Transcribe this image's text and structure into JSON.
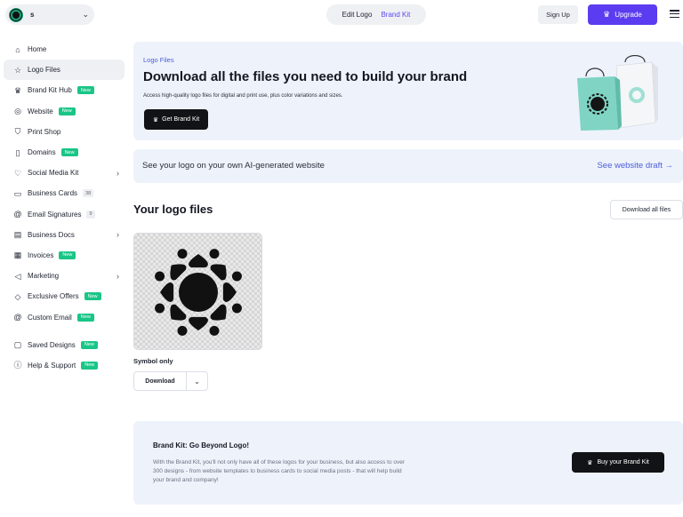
{
  "topbar": {
    "project_name": "s",
    "tabs": {
      "edit_logo": "Edit Logo",
      "brand_kit": "Brand Kit"
    },
    "sign_up": "Sign Up",
    "upgrade": "Upgrade"
  },
  "sidebar": {
    "items": [
      {
        "label": "Home",
        "icon": "home-icon"
      },
      {
        "label": "Logo Files",
        "icon": "star-icon",
        "active": true
      },
      {
        "label": "Brand Kit Hub",
        "icon": "crown-icon",
        "badge": "New"
      },
      {
        "label": "Website",
        "icon": "globe-icon",
        "badge": "New"
      },
      {
        "label": "Print Shop",
        "icon": "shirt-icon"
      },
      {
        "label": "Domains",
        "icon": "bookmark-icon",
        "badge": "New"
      },
      {
        "label": "Social Media Kit",
        "icon": "heart-icon",
        "chevron": true
      },
      {
        "label": "Business Cards",
        "icon": "card-icon",
        "count": "38"
      },
      {
        "label": "Email Signatures",
        "icon": "at-icon",
        "count": "9"
      },
      {
        "label": "Business Docs",
        "icon": "docs-icon",
        "chevron": true
      },
      {
        "label": "Invoices",
        "icon": "invoice-icon",
        "badge": "New"
      },
      {
        "label": "Marketing",
        "icon": "megaphone-icon",
        "chevron": true
      },
      {
        "label": "Exclusive Offers",
        "icon": "tag-icon",
        "badge": "New"
      },
      {
        "label": "Custom Email",
        "icon": "at-icon",
        "badge": "New"
      },
      {
        "label": "Saved Designs",
        "icon": "folder-icon",
        "badge": "New"
      },
      {
        "label": "Help & Support",
        "icon": "help-icon",
        "badge": "New"
      }
    ]
  },
  "hero": {
    "kicker": "Logo Files",
    "title": "Download all the files you need to build your brand",
    "subtitle": "Access high-quality logo files for digital and print use, plus color variations and sizes.",
    "button": "Get Brand Kit"
  },
  "website_strip": {
    "text": "See your logo on your own AI-generated website",
    "link": "See website draft →"
  },
  "logo_files": {
    "title": "Your logo files",
    "download_all": "Download all files",
    "card_caption": "Symbol only",
    "download": "Download"
  },
  "promo": {
    "title": "Brand Kit: Go Beyond Logo!",
    "body": "With the Brand Kit, you'll not only have all of these logos for your business, but also access to over 300 designs - from website templates to business cards to social media posts - that will help build your brand and company!",
    "button": "Buy your Brand Kit"
  },
  "colors": {
    "accent": "#5b3cf0",
    "badge_new": "#19c587",
    "panel_bg": "#eef2fb",
    "link": "#4a5dd8"
  }
}
